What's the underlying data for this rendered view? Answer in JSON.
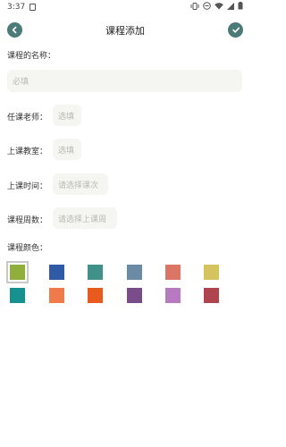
{
  "status_bar": {
    "time": "3:37"
  },
  "header": {
    "title": "课程添加"
  },
  "form": {
    "course_name_label": "课程的名称：",
    "course_name_placeholder": "必填",
    "teacher_label": "任课老师：",
    "teacher_placeholder": "选填",
    "classroom_label": "上课教室：",
    "classroom_placeholder": "选填",
    "time_label": "上课时间：",
    "time_placeholder": "请选择课次",
    "weeks_label": "课程周数：",
    "weeks_placeholder": "请选择上课周",
    "color_label": "课程颜色："
  },
  "colors": {
    "accent": "#4b7b78",
    "palette": [
      "#8fae3a",
      "#2e5aa6",
      "#3f9189",
      "#6a8ba6",
      "#dd7566",
      "#d5c35d",
      "#17918f",
      "#ef7a4a",
      "#e85a1d",
      "#7a4c8a",
      "#b77ac0",
      "#b0444e"
    ],
    "selected_index": 0
  },
  "icons": {
    "back": "chevron-left-icon",
    "confirm": "check-icon"
  }
}
